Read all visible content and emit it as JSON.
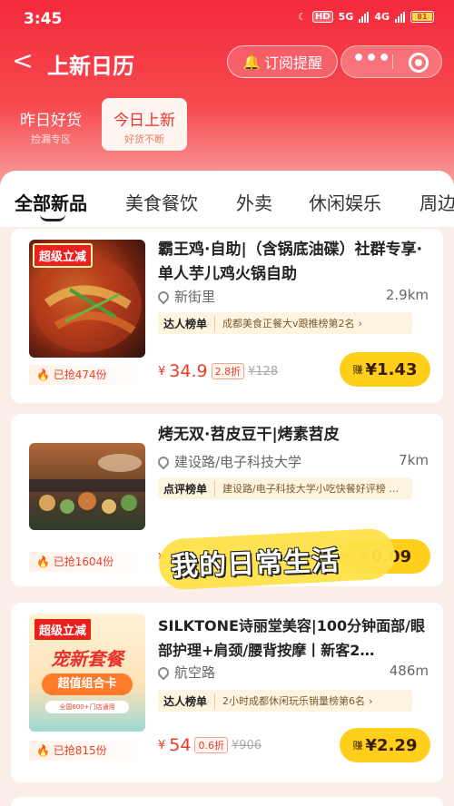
{
  "status_bar": {
    "time": "3:45",
    "hd": "HD",
    "net1": "5G",
    "net2": "4G",
    "battery": "81"
  },
  "navbar": {
    "back_label": "<",
    "title": "上新日历",
    "subscribe_label": "订阅提醒",
    "more_label": "•••"
  },
  "categories": [
    {
      "main": "昨日好货",
      "sub": "捡漏专区"
    },
    {
      "main": "今日上新",
      "sub": "好货不断"
    }
  ],
  "tabs": [
    "全部新品",
    "美食餐饮",
    "外卖",
    "休闲娱乐",
    "周边"
  ],
  "cards": [
    {
      "badge": "超级立减",
      "title": "霸王鸡·自助|（含锅底油碟）社群专享·单人芋儿鸡火锅自助",
      "location": "新街里",
      "distance": "2.9km",
      "rank_label": "达人榜单",
      "rank_text": "成都美食正餐大v跟推榜第2名",
      "currency": "¥",
      "price": "34.9",
      "discount": "2.8折",
      "original": "¥128",
      "sold": "已抢474份",
      "earn_label": "赚",
      "earn_value": "¥1.43"
    },
    {
      "title": "烤无双·苕皮豆干|烤素苕皮",
      "location": "建设路/电子科技大学",
      "distance": "7km",
      "rank_label": "点评榜单",
      "rank_text": "建设路/电子科技大学小吃快餐好评榜 …",
      "currency": "¥",
      "price_partial": "5",
      "sold": "已抢1604份",
      "earn_label": "赚",
      "earn_value": "0.09"
    },
    {
      "badge": "超级立减",
      "promo_big": "宠新套餐",
      "promo_btn": "超值组合卡",
      "promo_small": "全国600+门店通用",
      "title": "SILKTONE诗丽堂美容|100分钟面部/眼部护理+肩颈/腰背按摩丨新客2…",
      "location": "航空路",
      "distance": "486m",
      "rank_label": "达人榜单",
      "rank_text": "2小时成都休闲玩乐销量榜第6名",
      "currency": "¥",
      "price": "54",
      "discount": "0.6折",
      "original": "¥906",
      "sold": "已抢815份",
      "earn_label": "赚",
      "earn_value": "¥2.29"
    }
  ],
  "overlay_text": "我的日常生活",
  "colors": {
    "brand_red": "#f32a3c",
    "earn_yellow": "#ffcf1c",
    "price_red": "#f03a24"
  }
}
